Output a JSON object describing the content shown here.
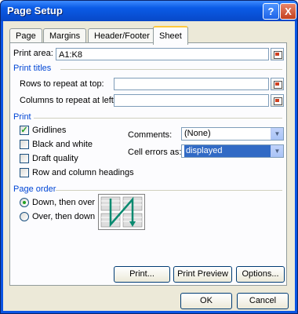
{
  "window": {
    "title": "Page Setup",
    "help_label": "?",
    "close_label": "X"
  },
  "tabs": [
    {
      "label": "Page"
    },
    {
      "label": "Margins"
    },
    {
      "label": "Header/Footer"
    },
    {
      "label": "Sheet",
      "active": true
    }
  ],
  "sheet": {
    "print_area_label": "Print area:",
    "print_area_value": "A1:K8",
    "print_titles_section": "Print titles",
    "rows_repeat_label": "Rows to repeat at top:",
    "rows_repeat_value": "",
    "cols_repeat_label": "Columns to repeat at left:",
    "cols_repeat_value": "",
    "print_section": "Print",
    "gridlines_label": "Gridlines",
    "gridlines_checked": true,
    "black_white_label": "Black and white",
    "draft_quality_label": "Draft quality",
    "row_col_headings_label": "Row and column headings",
    "comments_label": "Comments:",
    "comments_value": "(None)",
    "cell_errors_label": "Cell errors as:",
    "cell_errors_value": "displayed",
    "page_order_section": "Page order",
    "down_then_over_label": "Down, then over",
    "down_then_over_selected": true,
    "over_then_down_label": "Over, then down"
  },
  "buttons": {
    "print": "Print...",
    "print_preview": "Print Preview",
    "options": "Options...",
    "ok": "OK",
    "cancel": "Cancel"
  },
  "colors": {
    "section_text": "#0046d5",
    "title_bar": "#0a5be6",
    "selection": "#316ac5"
  }
}
